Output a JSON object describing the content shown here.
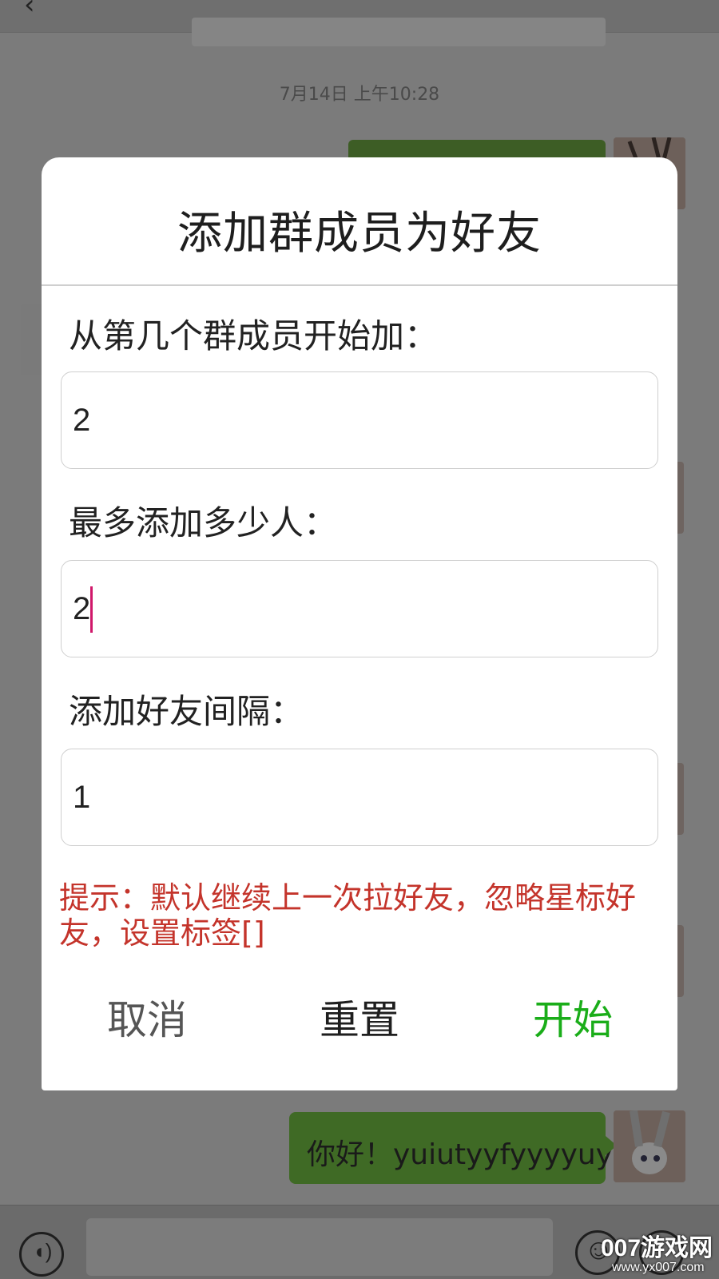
{
  "background": {
    "timestamp": "7月14日 上午10:28",
    "bottom_message": "你好！yuiutyyfyyyyuy"
  },
  "dialog": {
    "title": "添加群成员为好友",
    "fields": [
      {
        "label": "从第几个群成员开始加：",
        "value": "2"
      },
      {
        "label": "最多添加多少人：",
        "value": "2"
      },
      {
        "label": "添加好友间隔：",
        "value": "1"
      }
    ],
    "hint": "提示：默认继续上一次拉好友，忽略星标好友，设置标签[]",
    "buttons": {
      "cancel": "取消",
      "reset": "重置",
      "start": "开始"
    }
  },
  "colors": {
    "accent": "#1aad19",
    "hint": "#c4342b",
    "caret": "#d0186a"
  },
  "watermark": {
    "line1": "007游戏网",
    "line2": "www.yx007.com"
  }
}
